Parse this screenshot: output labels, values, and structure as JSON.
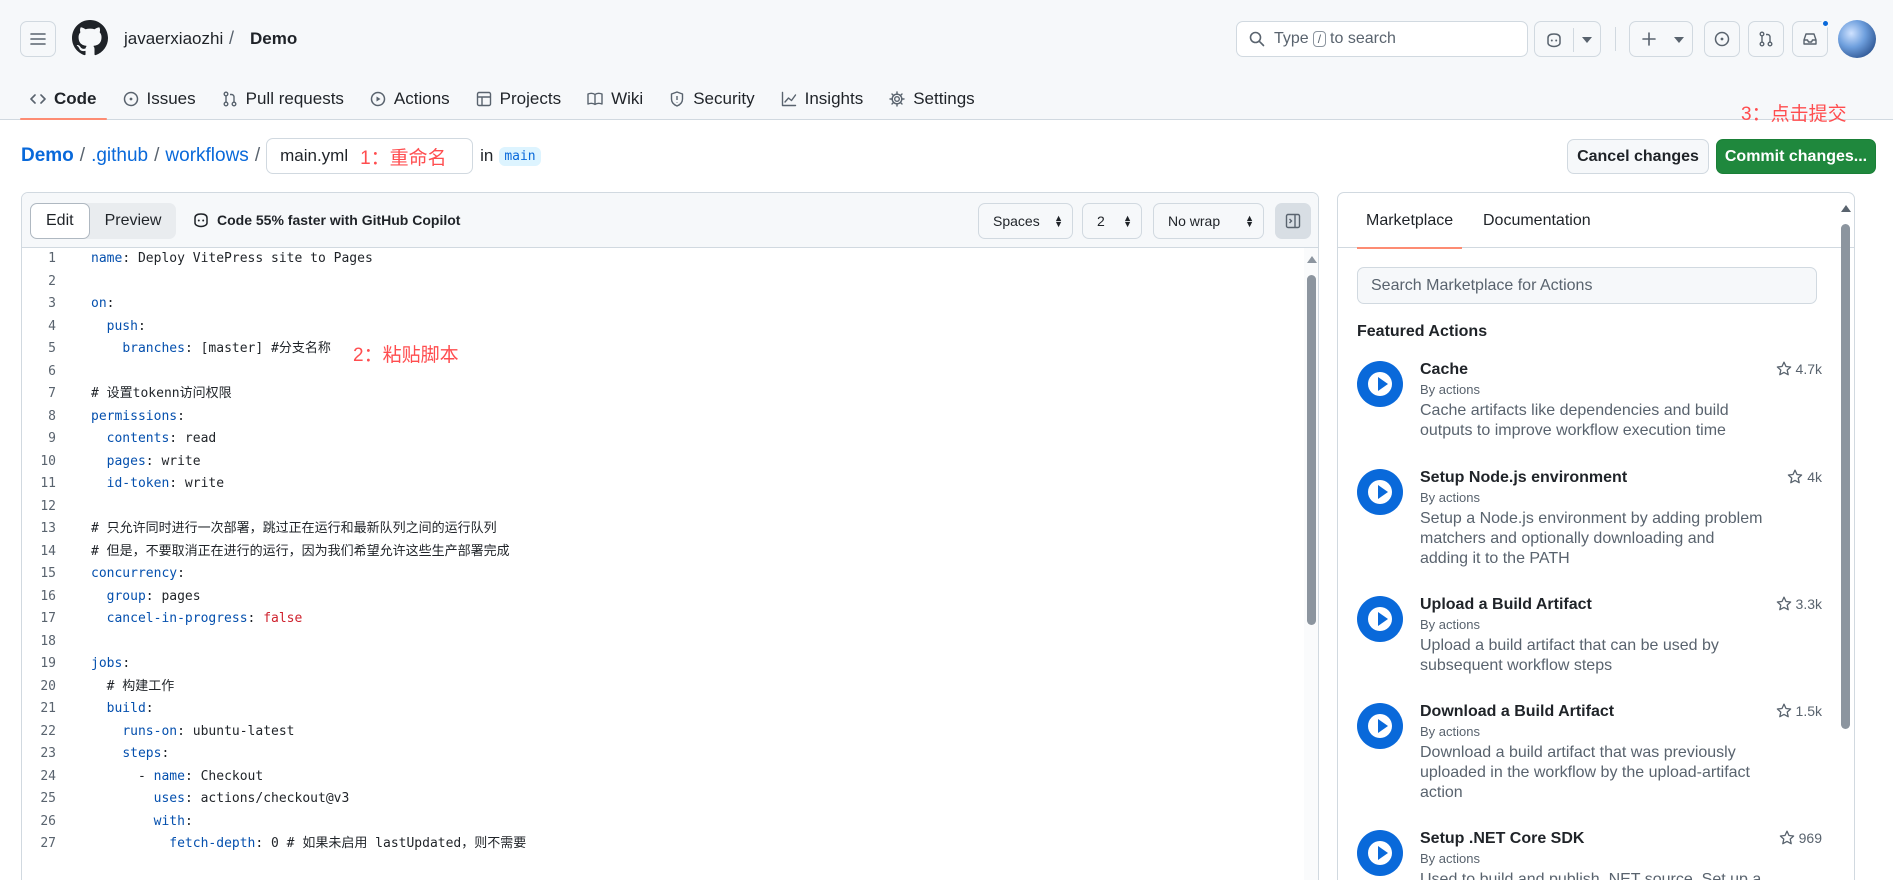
{
  "header": {
    "owner": "javaerxiaozhi",
    "slash": "/",
    "repo": "Demo",
    "search": {
      "prefix": "Type",
      "key": "/",
      "suffix": "to search"
    }
  },
  "nav": {
    "tabs": [
      {
        "label": "Code",
        "icon": "code-icon",
        "active": true
      },
      {
        "label": "Issues",
        "icon": "issue-opened-icon"
      },
      {
        "label": "Pull requests",
        "icon": "git-pull-request-icon"
      },
      {
        "label": "Actions",
        "icon": "play-icon"
      },
      {
        "label": "Projects",
        "icon": "table-icon"
      },
      {
        "label": "Wiki",
        "icon": "book-icon"
      },
      {
        "label": "Security",
        "icon": "shield-icon"
      },
      {
        "label": "Insights",
        "icon": "graph-icon"
      },
      {
        "label": "Settings",
        "icon": "gear-icon"
      }
    ]
  },
  "path": {
    "root": "Demo",
    "dir1": ".github",
    "dir2": "workflows",
    "sep": "/",
    "filename": "main.yml",
    "in_text": "in",
    "branch": "main"
  },
  "annotations": {
    "rename": "1：重命名",
    "paste": "2：粘贴脚本",
    "commit": "3：点击提交"
  },
  "actions_bar": {
    "cancel": "Cancel changes",
    "commit": "Commit changes..."
  },
  "editor": {
    "tab_edit": "Edit",
    "tab_preview": "Preview",
    "copilot_hint": "Code 55% faster with GitHub Copilot",
    "indent_mode": "Spaces",
    "indent_size": "2",
    "wrap_mode": "No wrap",
    "lines": [
      [
        [
          "k",
          "name"
        ],
        [
          "",
          ": Deploy VitePress site to Pages"
        ]
      ],
      [],
      [
        [
          "k",
          "on"
        ],
        [
          "",
          ":"
        ]
      ],
      [
        [
          "",
          "  "
        ],
        [
          "k",
          "push"
        ],
        [
          "",
          ":"
        ]
      ],
      [
        [
          "",
          "    "
        ],
        [
          "k",
          "branches"
        ],
        [
          "",
          ": [master] #分支名称"
        ]
      ],
      [],
      [
        [
          "",
          "# 设置tokenn访问权限"
        ]
      ],
      [
        [
          "k",
          "permissions"
        ],
        [
          "",
          ":"
        ]
      ],
      [
        [
          "",
          "  "
        ],
        [
          "k",
          "contents"
        ],
        [
          "",
          ": read"
        ]
      ],
      [
        [
          "",
          "  "
        ],
        [
          "k",
          "pages"
        ],
        [
          "",
          ": write"
        ]
      ],
      [
        [
          "",
          "  "
        ],
        [
          "k",
          "id-token"
        ],
        [
          "",
          ": write"
        ]
      ],
      [],
      [
        [
          "",
          "# 只允许同时进行一次部署，跳过正在运行和最新队列之间的运行队列"
        ]
      ],
      [
        [
          "",
          "# 但是，不要取消正在进行的运行，因为我们希望允许这些生产部署完成"
        ]
      ],
      [
        [
          "k",
          "concurrency"
        ],
        [
          "",
          ":"
        ]
      ],
      [
        [
          "",
          "  "
        ],
        [
          "k",
          "group"
        ],
        [
          "",
          ": pages"
        ]
      ],
      [
        [
          "",
          "  "
        ],
        [
          "k",
          "cancel-in-progress"
        ],
        [
          "",
          ": "
        ],
        [
          "f",
          "false"
        ]
      ],
      [],
      [
        [
          "k",
          "jobs"
        ],
        [
          "",
          ":"
        ]
      ],
      [
        [
          "",
          "  # 构建工作"
        ]
      ],
      [
        [
          "",
          "  "
        ],
        [
          "k",
          "build"
        ],
        [
          "",
          ":"
        ]
      ],
      [
        [
          "",
          "    "
        ],
        [
          "k",
          "runs-on"
        ],
        [
          "",
          ": ubuntu-latest"
        ]
      ],
      [
        [
          "",
          "    "
        ],
        [
          "k",
          "steps"
        ],
        [
          "",
          ":"
        ]
      ],
      [
        [
          "",
          "      - "
        ],
        [
          "k",
          "name"
        ],
        [
          "",
          ": Checkout"
        ]
      ],
      [
        [
          "",
          "        "
        ],
        [
          "k",
          "uses"
        ],
        [
          "",
          ": actions/checkout@v3"
        ]
      ],
      [
        [
          "",
          "        "
        ],
        [
          "k",
          "with"
        ],
        [
          "",
          ":"
        ]
      ],
      [
        [
          "",
          "          "
        ],
        [
          "k",
          "fetch-depth"
        ],
        [
          "",
          ": 0 # 如果未启用 lastUpdated，则不需要"
        ]
      ]
    ]
  },
  "marketplace": {
    "tab_marketplace": "Marketplace",
    "tab_documentation": "Documentation",
    "search_placeholder": "Search Marketplace for Actions",
    "featured_title": "Featured Actions",
    "items": [
      {
        "name": "Cache",
        "by": "By actions",
        "desc": "Cache artifacts like dependencies and build outputs to improve workflow execution time",
        "stars": "4.7k"
      },
      {
        "name": "Setup Node.js environment",
        "by": "By actions",
        "desc": "Setup a Node.js environment by adding problem matchers and optionally downloading and adding it to the PATH",
        "stars": "4k"
      },
      {
        "name": "Upload a Build Artifact",
        "by": "By actions",
        "desc": "Upload a build artifact that can be used by subsequent workflow steps",
        "stars": "3.3k"
      },
      {
        "name": "Download a Build Artifact",
        "by": "By actions",
        "desc": "Download a build artifact that was previously uploaded in the workflow by the upload-artifact action",
        "stars": "1.5k"
      },
      {
        "name": "Setup .NET Core SDK",
        "by": "By actions",
        "desc": "Used to build and publish .NET source. Set up a",
        "stars": "969"
      }
    ]
  },
  "colors": {
    "accent_blue": "#0969da",
    "commit_green": "#1f883d",
    "annotation_red": "#ff4d4f",
    "tab_underline": "#fd8c73"
  }
}
